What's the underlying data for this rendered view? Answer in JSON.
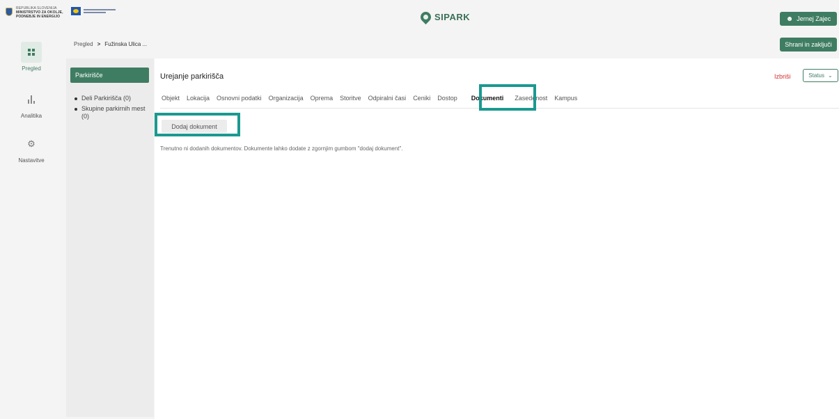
{
  "header": {
    "gov_logo_lines": [
      "REPUBLIKA SLOVENIJA",
      "MINISTRSTVO ZA OKOLJE,",
      "PODNEBJE IN ENERGIJO"
    ],
    "brand": "SIPARK",
    "user_name": "Jernej Zajec",
    "user_icon": "user-icon",
    "save_label": "Shrani in zaključi"
  },
  "nav": {
    "items": [
      {
        "label": "Pregled",
        "icon": "grid-icon",
        "active": true
      },
      {
        "label": "Analitika",
        "icon": "bar-chart-icon",
        "active": false
      },
      {
        "label": "Nastavitve",
        "icon": "gear-icon",
        "active": false
      }
    ]
  },
  "breadcrumb": {
    "root": "Pregled",
    "separator": ">",
    "current": "Fužinska Ulica ..."
  },
  "sidepanel": {
    "title": "Parkirišče",
    "items": [
      "Deli Parkirišča (0)",
      "Skupine parkirnih mest (0)"
    ]
  },
  "main": {
    "title": "Urejanje parkirišča",
    "delete_label": "Izbriši",
    "status_label": "Status",
    "tabs": [
      "Objekt",
      "Lokacija",
      "Osnovni podatki",
      "Organizacija",
      "Oprema",
      "Storitve",
      "Odpiralni časi",
      "Ceniki",
      "Dostop",
      "Dokumenti",
      "Zasedenost",
      "Kampus"
    ],
    "active_tab": "Dokumenti",
    "add_document_label": "Dodaj dokument",
    "empty_message": "Trenutno ni dodanih dokumentov. Dokumente lahko dodate z zgornjim gumbom \"dodaj dokument\"."
  },
  "colors": {
    "brand_green": "#3f7d62",
    "highlight": "#1b9990",
    "danger": "#d32f2f"
  }
}
